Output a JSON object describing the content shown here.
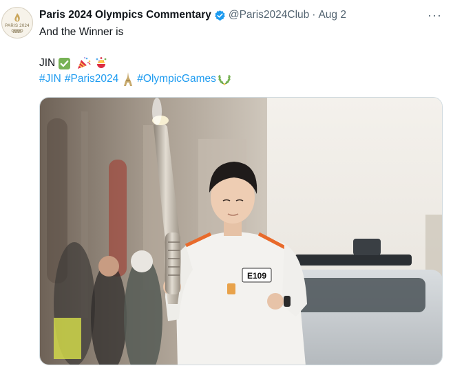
{
  "tweet": {
    "author_name": "Paris 2024 Olympics Commentary",
    "handle": "@Paris2024Club",
    "separator": "·",
    "date": "Aug 2",
    "more_label": "···",
    "avatar_text": "PARIS 2024",
    "line1": "And the Winner is",
    "line2": "JIN",
    "hashtags": [
      "#JIN",
      "#Paris2024",
      "#OlympicGames"
    ],
    "badge_text": "E109"
  },
  "colors": {
    "accent": "#1d9bf0",
    "verified": "#1d9bf0",
    "text": "#0f1419",
    "muted": "#536471"
  },
  "icons": [
    "verified-badge-icon",
    "more-icon",
    "check-mark-emoji-icon",
    "party-popper-emoji-icon",
    "confetti-ball-emoji-icon",
    "eiffel-tower-emoji-icon",
    "laurel-wreath-emoji-icon"
  ]
}
